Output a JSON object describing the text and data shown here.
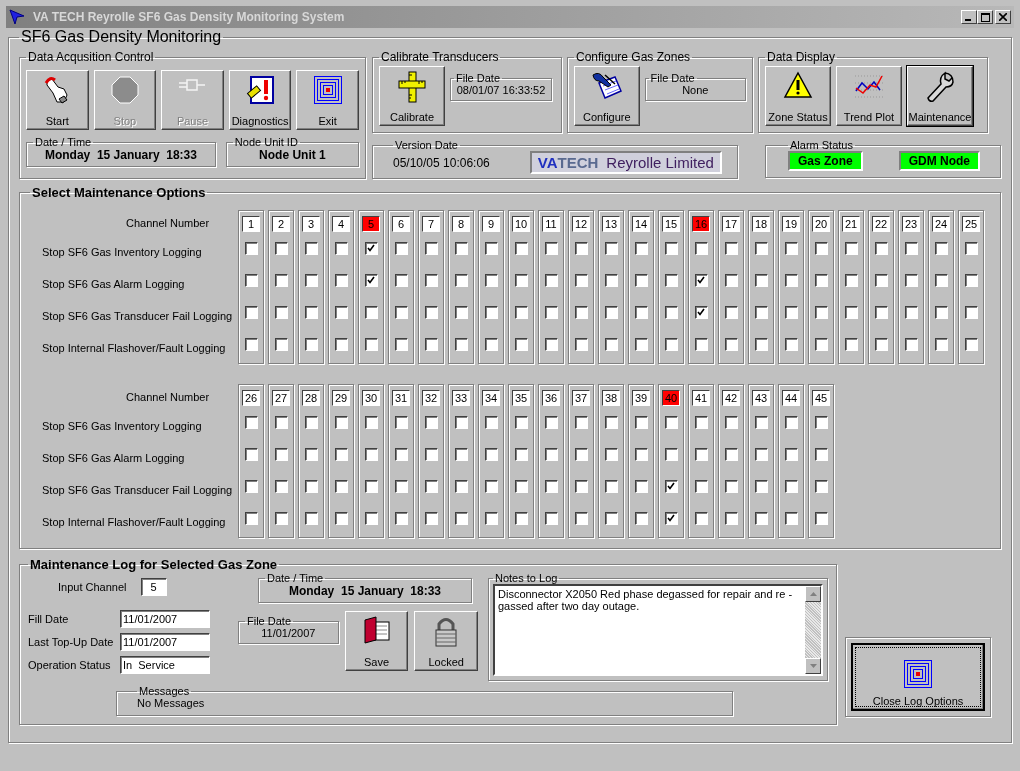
{
  "window": {
    "title": "VA TECH Reyrolle SF6 Gas Density Monitoring System"
  },
  "main": {
    "title": "SF6 Gas Density Monitoring"
  },
  "acquisition": {
    "title": "Data Acqusition Control",
    "buttons": [
      {
        "label": "Start",
        "disabled": false
      },
      {
        "label": "Stop",
        "disabled": true
      },
      {
        "label": "Pause",
        "disabled": true
      },
      {
        "label": "Diagnostics",
        "disabled": false
      },
      {
        "label": "Exit",
        "disabled": false
      }
    ],
    "datetime": {
      "title": "Date / Time",
      "value": "Monday  15 January  18:33"
    },
    "node": {
      "title": "Node Unit ID",
      "value": "Node Unit 1"
    }
  },
  "calibrate": {
    "title": "Calibrate Transducers",
    "button": "Calibrate",
    "file_date": {
      "title": "File Date",
      "value": "08/01/07 16:33:52"
    }
  },
  "configure": {
    "title": "Configure Gas Zones",
    "button": "Configure",
    "file_date": {
      "title": "File Date",
      "value": "None"
    }
  },
  "display": {
    "title": "Data Display",
    "buttons": [
      {
        "label": "Zone Status",
        "selected": false
      },
      {
        "label": "Trend Plot",
        "selected": false
      },
      {
        "label": "Maintenance",
        "selected": true
      }
    ]
  },
  "version": {
    "title": "Version Date",
    "value": "05/10/05 10:06:06",
    "logo": {
      "brand_a": "VA",
      "brand_b": "TECH",
      "company": "Reyrolle Limited"
    }
  },
  "alarm": {
    "title": "Alarm Status",
    "indicators": [
      {
        "label": "Gas Zone",
        "color": "#00ff00"
      },
      {
        "label": "GDM Node",
        "color": "#00ff00"
      }
    ]
  },
  "maintenance": {
    "title": "Select Maintenance Options",
    "groups": [
      {
        "channel_label": "Channel Number",
        "options": [
          "Stop SF6 Gas Inventory Logging",
          "Stop SF6 Gas Alarm Logging",
          "Stop SF6 Gas Transducer Fail Logging",
          "Stop Internal Flashover/Fault Logging"
        ],
        "channels": [
          {
            "number": "1",
            "highlighted": false,
            "checked": [
              false,
              false,
              false,
              false
            ]
          },
          {
            "number": "2",
            "highlighted": false,
            "checked": [
              false,
              false,
              false,
              false
            ]
          },
          {
            "number": "3",
            "highlighted": false,
            "checked": [
              false,
              false,
              false,
              false
            ]
          },
          {
            "number": "4",
            "highlighted": false,
            "checked": [
              false,
              false,
              false,
              false
            ]
          },
          {
            "number": "5",
            "highlighted": true,
            "checked": [
              true,
              true,
              false,
              false
            ]
          },
          {
            "number": "6",
            "highlighted": false,
            "checked": [
              false,
              false,
              false,
              false
            ]
          },
          {
            "number": "7",
            "highlighted": false,
            "checked": [
              false,
              false,
              false,
              false
            ]
          },
          {
            "number": "8",
            "highlighted": false,
            "checked": [
              false,
              false,
              false,
              false
            ]
          },
          {
            "number": "9",
            "highlighted": false,
            "checked": [
              false,
              false,
              false,
              false
            ]
          },
          {
            "number": "10",
            "highlighted": false,
            "checked": [
              false,
              false,
              false,
              false
            ]
          },
          {
            "number": "11",
            "highlighted": false,
            "checked": [
              false,
              false,
              false,
              false
            ]
          },
          {
            "number": "12",
            "highlighted": false,
            "checked": [
              false,
              false,
              false,
              false
            ]
          },
          {
            "number": "13",
            "highlighted": false,
            "checked": [
              false,
              false,
              false,
              false
            ]
          },
          {
            "number": "14",
            "highlighted": false,
            "checked": [
              false,
              false,
              false,
              false
            ]
          },
          {
            "number": "15",
            "highlighted": false,
            "checked": [
              false,
              false,
              false,
              false
            ]
          },
          {
            "number": "16",
            "highlighted": true,
            "checked": [
              false,
              true,
              true,
              false
            ]
          },
          {
            "number": "17",
            "highlighted": false,
            "checked": [
              false,
              false,
              false,
              false
            ]
          },
          {
            "number": "18",
            "highlighted": false,
            "checked": [
              false,
              false,
              false,
              false
            ]
          },
          {
            "number": "19",
            "highlighted": false,
            "checked": [
              false,
              false,
              false,
              false
            ]
          },
          {
            "number": "20",
            "highlighted": false,
            "checked": [
              false,
              false,
              false,
              false
            ]
          },
          {
            "number": "21",
            "highlighted": false,
            "checked": [
              false,
              false,
              false,
              false
            ]
          },
          {
            "number": "22",
            "highlighted": false,
            "checked": [
              false,
              false,
              false,
              false
            ]
          },
          {
            "number": "23",
            "highlighted": false,
            "checked": [
              false,
              false,
              false,
              false
            ]
          },
          {
            "number": "24",
            "highlighted": false,
            "checked": [
              false,
              false,
              false,
              false
            ]
          },
          {
            "number": "25",
            "highlighted": false,
            "checked": [
              false,
              false,
              false,
              false
            ]
          }
        ]
      },
      {
        "channel_label": "Channel Number",
        "options": [
          "Stop SF6 Gas Inventory Logging",
          "Stop SF6 Gas Alarm Logging",
          "Stop SF6 Gas Transducer Fail Logging",
          "Stop Internal Flashover/Fault Logging"
        ],
        "channels": [
          {
            "number": "26",
            "highlighted": false,
            "checked": [
              false,
              false,
              false,
              false
            ]
          },
          {
            "number": "27",
            "highlighted": false,
            "checked": [
              false,
              false,
              false,
              false
            ]
          },
          {
            "number": "28",
            "highlighted": false,
            "checked": [
              false,
              false,
              false,
              false
            ]
          },
          {
            "number": "29",
            "highlighted": false,
            "checked": [
              false,
              false,
              false,
              false
            ]
          },
          {
            "number": "30",
            "highlighted": false,
            "checked": [
              false,
              false,
              false,
              false
            ]
          },
          {
            "number": "31",
            "highlighted": false,
            "checked": [
              false,
              false,
              false,
              false
            ]
          },
          {
            "number": "32",
            "highlighted": false,
            "checked": [
              false,
              false,
              false,
              false
            ]
          },
          {
            "number": "33",
            "highlighted": false,
            "checked": [
              false,
              false,
              false,
              false
            ]
          },
          {
            "number": "34",
            "highlighted": false,
            "checked": [
              false,
              false,
              false,
              false
            ]
          },
          {
            "number": "35",
            "highlighted": false,
            "checked": [
              false,
              false,
              false,
              false
            ]
          },
          {
            "number": "36",
            "highlighted": false,
            "checked": [
              false,
              false,
              false,
              false
            ]
          },
          {
            "number": "37",
            "highlighted": false,
            "checked": [
              false,
              false,
              false,
              false
            ]
          },
          {
            "number": "38",
            "highlighted": false,
            "checked": [
              false,
              false,
              false,
              false
            ]
          },
          {
            "number": "39",
            "highlighted": false,
            "checked": [
              false,
              false,
              false,
              false
            ]
          },
          {
            "number": "40",
            "highlighted": true,
            "checked": [
              false,
              false,
              true,
              true
            ]
          },
          {
            "number": "41",
            "highlighted": false,
            "checked": [
              false,
              false,
              false,
              false
            ]
          },
          {
            "number": "42",
            "highlighted": false,
            "checked": [
              false,
              false,
              false,
              false
            ]
          },
          {
            "number": "43",
            "highlighted": false,
            "checked": [
              false,
              false,
              false,
              false
            ]
          },
          {
            "number": "44",
            "highlighted": false,
            "checked": [
              false,
              false,
              false,
              false
            ]
          },
          {
            "number": "45",
            "highlighted": false,
            "checked": [
              false,
              false,
              false,
              false
            ]
          }
        ]
      }
    ]
  },
  "log": {
    "title": "Maintenance Log for Selected Gas Zone",
    "input_channel": {
      "label": "Input Channel",
      "value": "5"
    },
    "fields": [
      {
        "label": "Fill Date",
        "value": "11/01/2007"
      },
      {
        "label": "Last Top-Up Date",
        "value": "11/01/2007"
      },
      {
        "label": "Operation Status",
        "value": "In  Service"
      }
    ],
    "datetime": {
      "title": "Date / Time",
      "value": "Monday  15 January  18:33"
    },
    "file_date": {
      "title": "File Date",
      "value": "11/01/2007"
    },
    "buttons": [
      "Save",
      "Locked"
    ],
    "notes": {
      "title": "Notes to Log",
      "value": "Disconnector  X2050 Red phase degassed for repair and re -gassed after two day outage."
    },
    "messages": {
      "title": "Messages",
      "value": "No Messages"
    }
  },
  "close_button": {
    "label": "Close Log Options",
    "focused": true
  }
}
